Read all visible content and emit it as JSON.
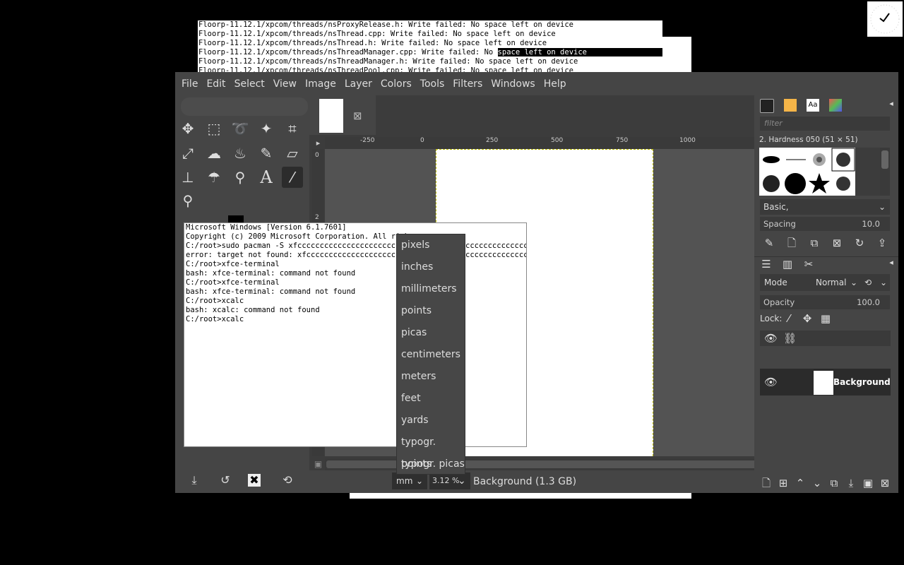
{
  "top_terminal": {
    "lines": [
      "Floorp-11.12.1/xpcom/threads/nsProxyRelease.h: Write failed: No space left on device",
      "Floorp-11.12.1/xpcom/threads/nsThread.cpp: Write failed: No space left on device",
      "Floorp-11.12.1/xpcom/threads/nsThread.h: Write failed: No space left on device",
      "Floorp-11.12.1/xpcom/threads/nsThreadManager.cpp: Write failed: No ",
      "Floorp-11.12.1/xpcom/threads/nsThreadManager.h: Write failed: No space left on device",
      "Floorp-11.12.1/xpcom/threads/nsThreadPool.cpp: Write failed: No space left on device"
    ],
    "selected_text": "space left on device"
  },
  "clock": {
    "icon": "clock-icon"
  },
  "gimp": {
    "menu": [
      "File",
      "Edit",
      "Select",
      "View",
      "Image",
      "Layer",
      "Colors",
      "Tools",
      "Filters",
      "Windows",
      "Help"
    ],
    "ruler_labels": [
      "-250",
      "0",
      "250",
      "500",
      "750",
      "1000"
    ],
    "ruler_v_labels": [
      "0",
      "2"
    ],
    "status": {
      "unit": "mm",
      "zoom": "3.12 %",
      "text": "Background (1.3 GB)"
    },
    "dock": {
      "filter_placeholder": "filter",
      "brush_name": "2. Hardness 050 (51 × 51)",
      "brush_set": "Basic,",
      "spacing_label": "Spacing",
      "spacing_value": "10.0",
      "mode_label": "Mode",
      "mode_value": "Normal",
      "opacity_label": "Opacity",
      "opacity_value": "100.0",
      "lock_label": "Lock:",
      "layer_name": "Background"
    }
  },
  "cmd": {
    "lines": [
      "Microsoft Windows [Version 6.1.7601]",
      "Copyright (c) 2009 Microsoft Corporation. All righ",
      "",
      "C:/root>sudo pacman -S xfcccccccccccccccccccccccc",
      "error: target not found: xfccccccccccccccccccccccc",
      "C:/root>xfce-terminal",
      "bash: xfce-terminal: command not found",
      "C:/root>xfce-terminal",
      "bash: xfce-terminal: command not found",
      "C:/root>xcalc",
      "bash: xcalc: command not found",
      "C:/root>xcalc"
    ],
    "line3_tail": "cccccccccccccc",
    "line4_tail": "cccccccccccccccc"
  },
  "unit_menu": {
    "items": [
      "pixels",
      "inches",
      "millimeters",
      "points",
      "picas",
      "centimeters",
      "meters",
      "feet",
      "yards",
      "typogr. points",
      "typogr. picas"
    ]
  }
}
